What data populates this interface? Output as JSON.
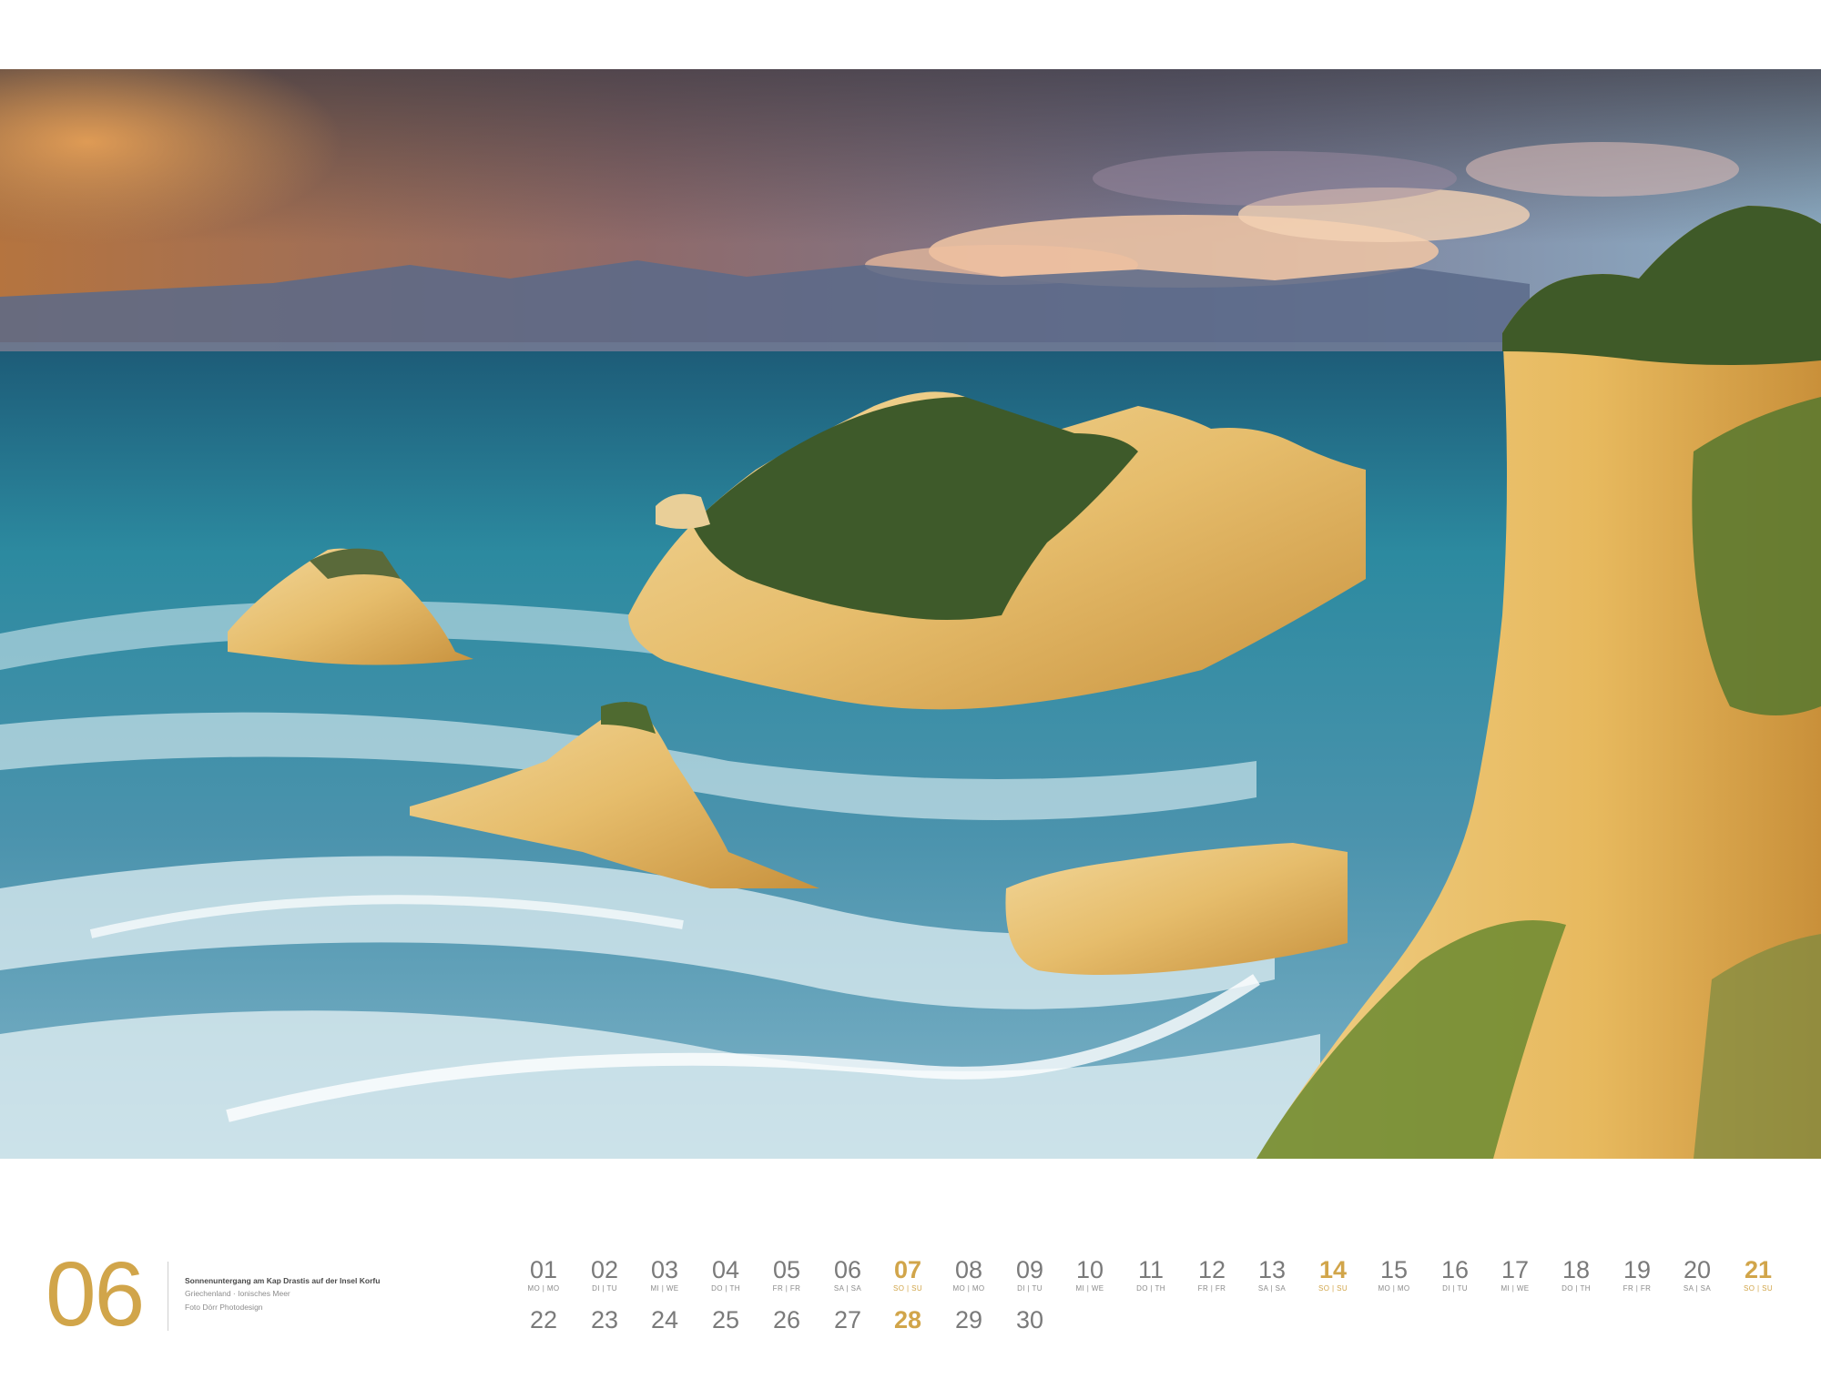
{
  "month": {
    "number": "06",
    "caption_title": "Sonnenuntergang am Kap Drastis auf der Insel Korfu",
    "caption_region": "Griechenland · Ionisches Meer",
    "caption_credit": "Foto Dörr Photodesign"
  },
  "colors": {
    "accent": "#d1a54a",
    "text_grey": "#7a7a7a"
  },
  "row1": [
    {
      "num": "01",
      "wd": "MO | MO",
      "sunday": false
    },
    {
      "num": "02",
      "wd": "DI | TU",
      "sunday": false
    },
    {
      "num": "03",
      "wd": "MI | WE",
      "sunday": false
    },
    {
      "num": "04",
      "wd": "DO | TH",
      "sunday": false
    },
    {
      "num": "05",
      "wd": "FR | FR",
      "sunday": false
    },
    {
      "num": "06",
      "wd": "SA | SA",
      "sunday": false
    },
    {
      "num": "07",
      "wd": "SO | SU",
      "sunday": true
    },
    {
      "num": "08",
      "wd": "MO | MO",
      "sunday": false
    },
    {
      "num": "09",
      "wd": "DI | TU",
      "sunday": false
    },
    {
      "num": "10",
      "wd": "MI | WE",
      "sunday": false
    },
    {
      "num": "11",
      "wd": "DO | TH",
      "sunday": false
    },
    {
      "num": "12",
      "wd": "FR | FR",
      "sunday": false
    },
    {
      "num": "13",
      "wd": "SA | SA",
      "sunday": false
    },
    {
      "num": "14",
      "wd": "SO | SU",
      "sunday": true
    },
    {
      "num": "15",
      "wd": "MO | MO",
      "sunday": false
    },
    {
      "num": "16",
      "wd": "DI | TU",
      "sunday": false
    },
    {
      "num": "17",
      "wd": "MI | WE",
      "sunday": false
    },
    {
      "num": "18",
      "wd": "DO | TH",
      "sunday": false
    },
    {
      "num": "19",
      "wd": "FR | FR",
      "sunday": false
    },
    {
      "num": "20",
      "wd": "SA | SA",
      "sunday": false
    },
    {
      "num": "21",
      "wd": "SO | SU",
      "sunday": true
    }
  ],
  "row2": [
    {
      "num": "22",
      "sunday": false
    },
    {
      "num": "23",
      "sunday": false
    },
    {
      "num": "24",
      "sunday": false
    },
    {
      "num": "25",
      "sunday": false
    },
    {
      "num": "26",
      "sunday": false
    },
    {
      "num": "27",
      "sunday": false
    },
    {
      "num": "28",
      "sunday": true
    },
    {
      "num": "29",
      "sunday": false
    },
    {
      "num": "30",
      "sunday": false
    }
  ]
}
